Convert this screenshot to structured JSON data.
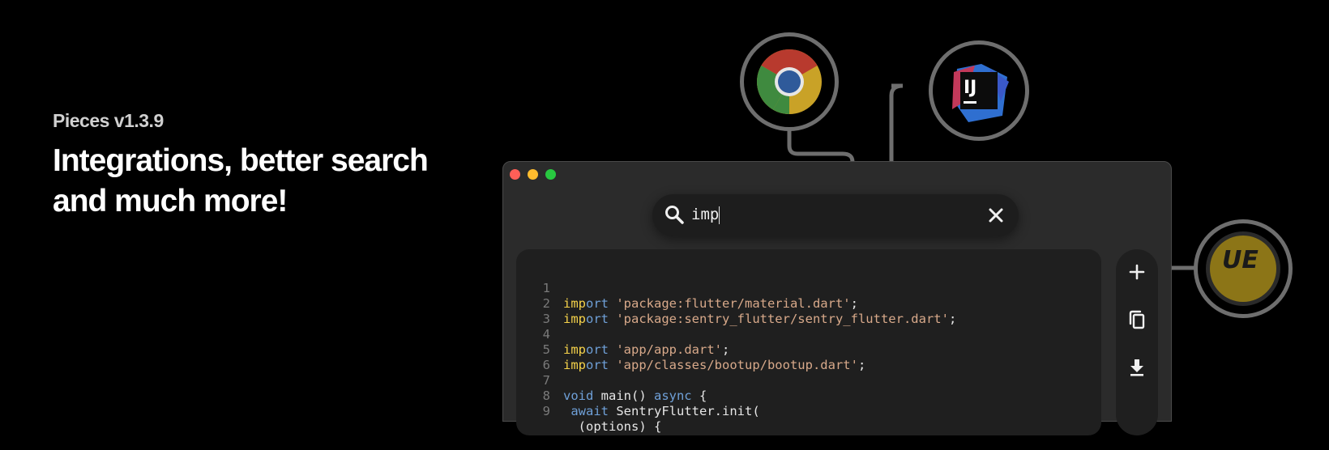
{
  "hero": {
    "version": "Pieces v1.3.9",
    "headline_line1": "Integrations, better search",
    "headline_line2": "and much more!"
  },
  "integrations": [
    {
      "name": "chrome-icon",
      "label": ""
    },
    {
      "name": "intellij-icon",
      "label": "IJ"
    },
    {
      "name": "unreal-engine-icon",
      "label": "UE"
    }
  ],
  "window": {
    "traffic_lights": [
      "#ff5f57",
      "#febc2e",
      "#28c840"
    ]
  },
  "search": {
    "query": "imp",
    "icons": {
      "search": "search-icon",
      "clear": "close-icon"
    }
  },
  "code": {
    "lines": [
      {
        "n": "1",
        "hl": "imp",
        "rest_kw": "ort",
        "after": " ",
        "str": "'package:flutter/material.dart'",
        "tail": ";"
      },
      {
        "n": "2",
        "hl": "imp",
        "rest_kw": "ort",
        "after": " ",
        "str": "'package:sentry_flutter/sentry_flutter.dart'",
        "tail": ";"
      },
      {
        "n": "3",
        "hl": "",
        "rest_kw": "",
        "after": "",
        "str": "",
        "tail": ""
      },
      {
        "n": "4",
        "hl": "imp",
        "rest_kw": "ort",
        "after": " ",
        "str": "'app/app.dart'",
        "tail": ";"
      },
      {
        "n": "5",
        "hl": "imp",
        "rest_kw": "ort",
        "after": " ",
        "str": "'app/classes/bootup/bootup.dart'",
        "tail": ";"
      },
      {
        "n": "6",
        "hl": "",
        "rest_kw": "",
        "after": "",
        "str": "",
        "tail": ""
      },
      {
        "n": "7",
        "kw1": "void",
        "mid": " main() ",
        "kw2": "async",
        "end": " {"
      },
      {
        "n": "8",
        "pre": " ",
        "kw1": "await",
        "mid": " SentryFlutter.init(",
        "kw2": "",
        "end": ""
      },
      {
        "n": "9",
        "pre": "  ",
        "kw1": "",
        "mid": "(options) {",
        "kw2": "",
        "end": ""
      }
    ]
  },
  "actions": [
    {
      "name": "add-button",
      "icon": "plus-icon"
    },
    {
      "name": "copy-button",
      "icon": "copy-icon"
    },
    {
      "name": "download-button",
      "icon": "download-icon"
    }
  ]
}
